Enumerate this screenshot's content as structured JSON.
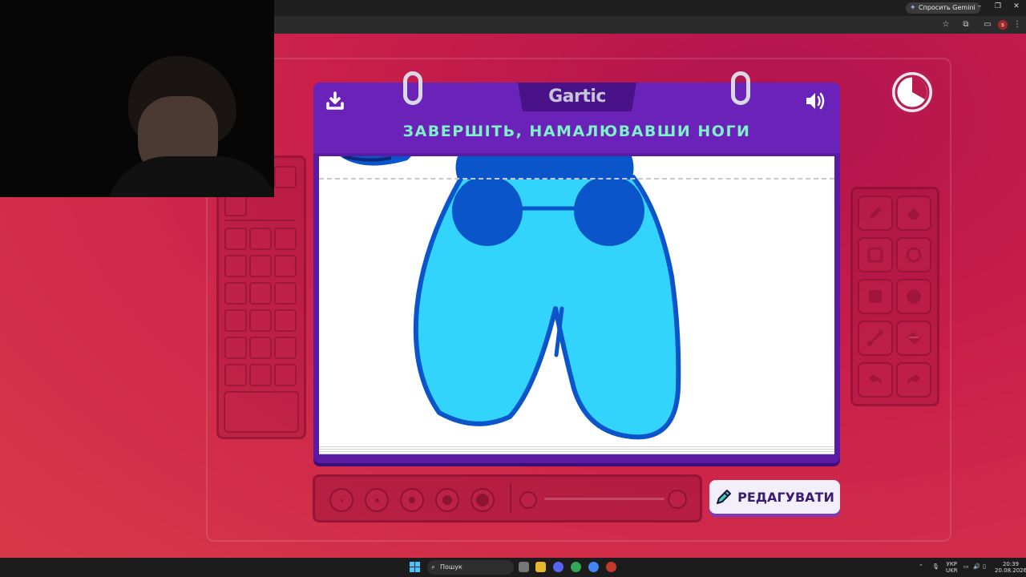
{
  "browser": {
    "gemini_button": "Спросить Gemini",
    "profile_initial": "s"
  },
  "game": {
    "logo": "Gartic",
    "instruction": "ЗАВЕРШІТЬ, НАМАЛЮВАВШИ НОГИ",
    "edit_button": "РЕДАГУВАТИ",
    "colors": {
      "background": "#c91f4a",
      "notebook": "#5b1aa3",
      "instruction_text": "#7ff0c9",
      "drawing_fill": "#33d4fb",
      "drawing_outline": "#0a55c9"
    },
    "icons": {
      "download": "download-icon",
      "sound": "speaker-icon",
      "timer": "timer-icon",
      "edit": "pencil-icon"
    },
    "tools": [
      "pencil",
      "eraser",
      "rectangle-outline",
      "circle-outline",
      "rectangle-filled",
      "circle-filled",
      "line",
      "fill-bucket",
      "undo",
      "redo"
    ]
  },
  "taskbar": {
    "search": "Пошук",
    "lang_top": "УКР",
    "lang_bottom": "UKR",
    "time": "20:39",
    "date": "20.08.2026"
  }
}
